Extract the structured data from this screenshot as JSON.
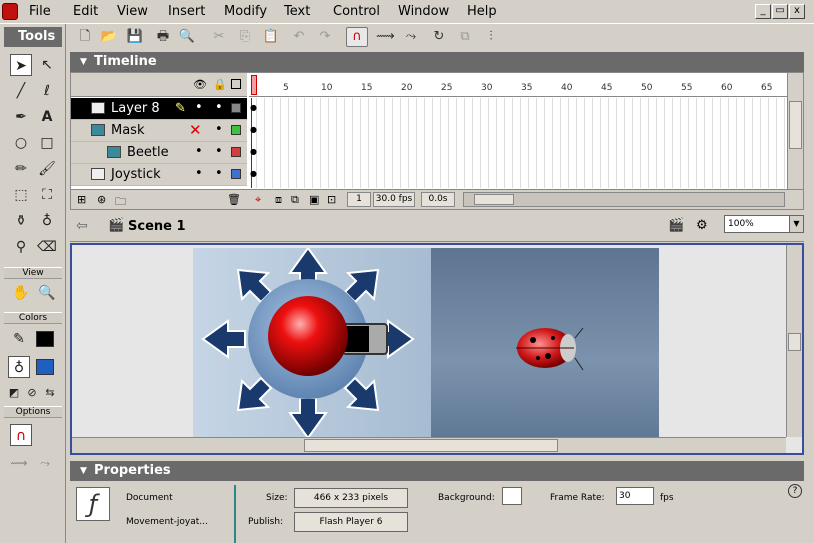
{
  "menu": {
    "items": [
      "File",
      "Edit",
      "View",
      "Insert",
      "Modify",
      "Text",
      "Control",
      "Window",
      "Help"
    ],
    "window_buttons": [
      "_",
      "▭",
      "x"
    ]
  },
  "toolbar": {
    "icons": [
      "new-icon",
      "open-icon",
      "save-icon",
      "print-icon",
      "print-preview-icon",
      "cut-icon",
      "copy-icon",
      "paste-icon",
      "undo-icon",
      "redo-icon",
      "snap-magnet-icon",
      "smooth-icon",
      "straighten-icon",
      "rotate-icon",
      "scale-icon",
      "align-icon"
    ]
  },
  "tools": {
    "title": "Tools",
    "view_label": "View",
    "colors_label": "Colors",
    "options_label": "Options",
    "stroke_color": "#000000",
    "fill_color": "#1f5fbf"
  },
  "timeline": {
    "title": "Timeline",
    "frame_numbers": [
      "1",
      "5",
      "10",
      "15",
      "20",
      "25",
      "30",
      "35",
      "40",
      "45",
      "50",
      "55",
      "60",
      "65"
    ],
    "layers": [
      {
        "name": "Layer 8",
        "color": "#888888",
        "selected": true
      },
      {
        "name": "Mask",
        "color": "#40c040",
        "selected": false
      },
      {
        "name": "Beetle",
        "color": "#d04040",
        "selected": false
      },
      {
        "name": "Joystick",
        "color": "#4070d0",
        "selected": false
      }
    ],
    "current_frame": "1",
    "fps": "30.0 fps",
    "elapsed": "0.0s"
  },
  "scene": {
    "name": "Scene 1",
    "zoom": "100%"
  },
  "properties": {
    "title": "Properties",
    "doc_type": "Document",
    "doc_name": "Movement-joyat...",
    "size_label": "Size:",
    "size_value": "466 x 233 pixels",
    "publish_label": "Publish:",
    "publish_value": "Flash Player 6",
    "background_label": "Background:",
    "frame_rate_label": "Frame Rate:",
    "frame_rate_value": "30",
    "fps_label": "fps",
    "help": "?"
  }
}
